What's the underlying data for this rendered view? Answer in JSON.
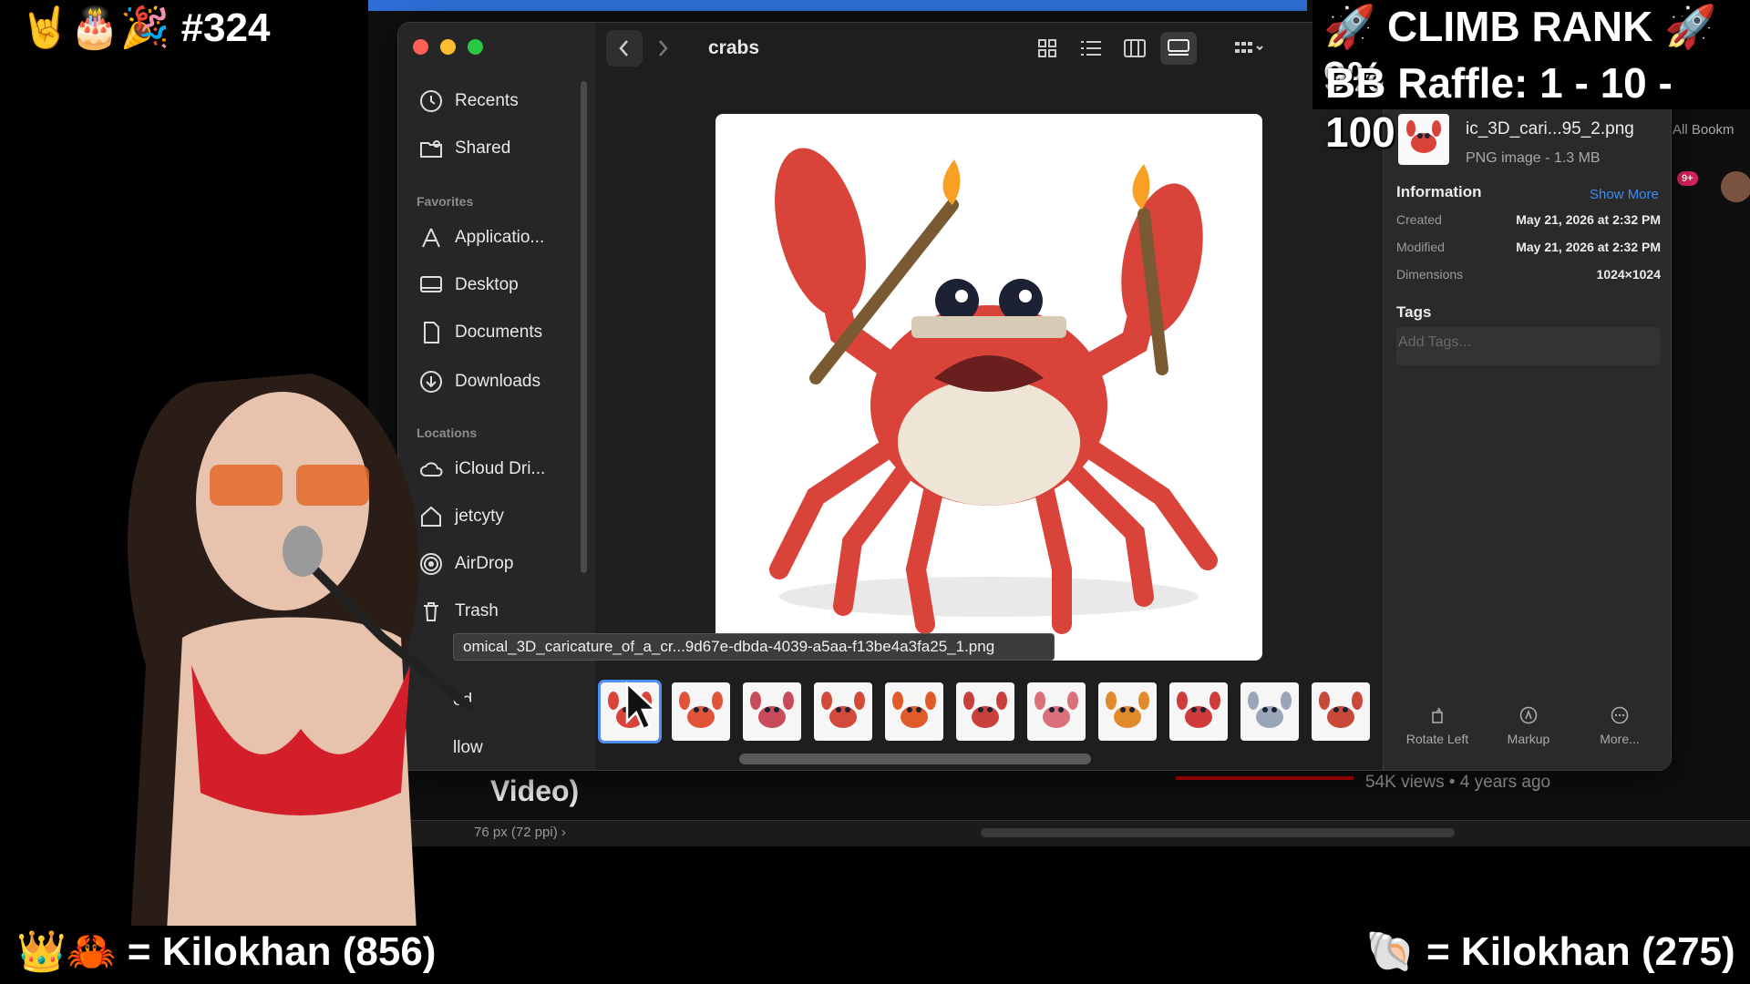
{
  "overlay": {
    "top_left": "🤘🎂🎉 #324",
    "climb_rank": "🚀 CLIMB RANK 🚀 9%",
    "bb_raffle": "BB Raffle: 1 - 10 - 100",
    "bottom_left": "👑🦀 = Kilokhan (856)",
    "bottom_right": "🐚 =  Kilokhan (275)"
  },
  "background_page": {
    "video_title": "Video)",
    "views": "54K views • 4 years ago",
    "status_text": "76 px (72 ppi)  ›",
    "bookmarks": "All Bookm",
    "badge": "9+"
  },
  "finder": {
    "folder_title": "crabs",
    "sidebar": {
      "items_top": [
        {
          "label": "Recents",
          "icon": "clock-icon"
        },
        {
          "label": "Shared",
          "icon": "shared-folder-icon"
        }
      ],
      "favorites_heading": "Favorites",
      "favorites": [
        {
          "label": "Applicatio...",
          "icon": "applications-icon"
        },
        {
          "label": "Desktop",
          "icon": "desktop-icon"
        },
        {
          "label": "Documents",
          "icon": "document-icon"
        },
        {
          "label": "Downloads",
          "icon": "download-icon"
        }
      ],
      "locations_heading": "Locations",
      "locations": [
        {
          "label": "iCloud Dri...",
          "icon": "cloud-icon"
        },
        {
          "label": "jetcyty",
          "icon": "home-icon"
        },
        {
          "label": "AirDrop",
          "icon": "airdrop-icon"
        },
        {
          "label": "Trash",
          "icon": "trash-icon"
        }
      ],
      "tag_partial_1": "ed",
      "tag_partial_2": "llow"
    },
    "tooltip": "omical_3D_caricature_of_a_cr...9d67e-dbda-4039-a5aa-f13be4a3fa25_1.png",
    "thumbnail_count": 11,
    "inspector": {
      "file_name": "ic_3D_cari...95_2.png",
      "file_type": "PNG image - 1.3 MB",
      "info_heading": "Information",
      "show_more": "Show More",
      "rows": [
        {
          "key": "Created",
          "value": "May 21, 2026 at 2:32 PM"
        },
        {
          "key": "Modified",
          "value": "May 21, 2026 at 2:32 PM"
        },
        {
          "key": "Dimensions",
          "value": "1024×1024"
        }
      ],
      "tags_heading": "Tags",
      "tags_placeholder": "Add Tags...",
      "actions": [
        {
          "label": "Rotate Left",
          "icon": "rotate-left-icon"
        },
        {
          "label": "Markup",
          "icon": "markup-icon"
        },
        {
          "label": "More...",
          "icon": "more-icon"
        }
      ]
    }
  },
  "colors": {
    "accent": "#3c8cf4",
    "crab_red": "#d9433a",
    "sidebar_bg": "#262626"
  }
}
